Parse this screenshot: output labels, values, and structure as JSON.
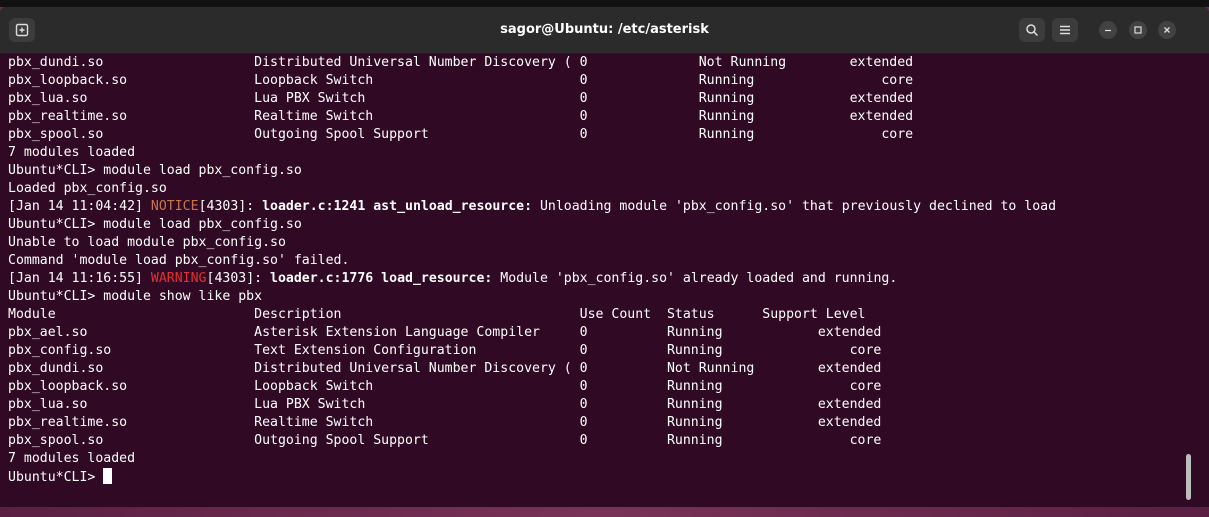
{
  "window": {
    "title": "sagor@Ubuntu: /etc/asterisk"
  },
  "icons": {
    "new_tab": "new-tab-icon",
    "search": "search-icon",
    "menu": "hamburger-menu-icon",
    "minimize": "minimize-icon",
    "maximize": "maximize-icon",
    "close": "close-icon"
  },
  "colors": {
    "terminal_bg": "#300a24",
    "text": "#ffffff",
    "notice": "#c7754f",
    "warning": "#e03232"
  },
  "terminal": {
    "lines": [
      "pbx_dundi.so                   Distributed Universal Number Discovery ( 0              Not Running        extended",
      "pbx_loopback.so                Loopback Switch                          0              Running                core",
      "pbx_lua.so                     Lua PBX Switch                           0              Running            extended",
      "pbx_realtime.so                Realtime Switch                          0              Running            extended",
      "pbx_spool.so                   Outgoing Spool Support                   0              Running                core",
      "7 modules loaded",
      "Ubuntu*CLI> module load pbx_config.so",
      "Loaded pbx_config.so",
      {
        "pre": "[Jan 14 11:04:42] ",
        "level": "NOTICE",
        "mid": "[4303]: ",
        "source": "loader.c:1241 ast_unload_resource:",
        "msg": " Unloading module 'pbx_config.so' that previously declined to load"
      },
      "Ubuntu*CLI> module load pbx_config.so",
      "Unable to load module pbx_config.so",
      "Command 'module load pbx_config.so' failed.",
      {
        "pre": "[Jan 14 11:16:55] ",
        "level": "WARNING",
        "mid": "[4303]: ",
        "source": "loader.c:1776 load_resource:",
        "msg": " Module 'pbx_config.so' already loaded and running."
      },
      "Ubuntu*CLI> module show like pbx",
      "Module                         Description                              Use Count  Status      Support Level",
      "pbx_ael.so                     Asterisk Extension Language Compiler     0          Running            extended",
      "pbx_config.so                  Text Extension Configuration             0          Running                core",
      "pbx_dundi.so                   Distributed Universal Number Discovery ( 0          Not Running        extended",
      "pbx_loopback.so                Loopback Switch                          0          Running                core",
      "pbx_lua.so                     Lua PBX Switch                           0          Running            extended",
      "pbx_realtime.so                Realtime Switch                          0          Running            extended",
      "pbx_spool.so                   Outgoing Spool Support                   0          Running                core",
      "7 modules loaded"
    ],
    "prompt": "Ubuntu*CLI> "
  }
}
